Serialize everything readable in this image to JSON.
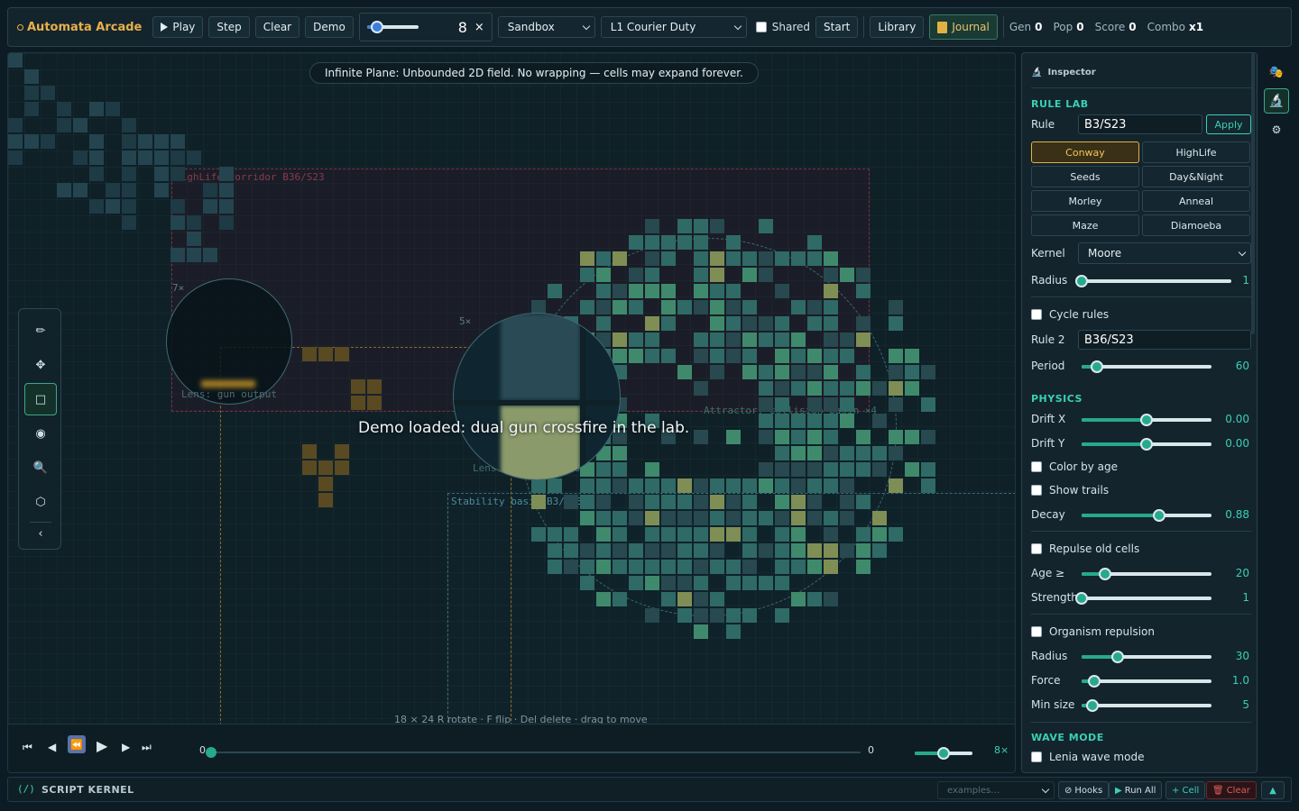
{
  "app": {
    "title": "Automata Arcade"
  },
  "toolbar": {
    "play_label": "Play",
    "step_label": "Step",
    "clear_label": "Clear",
    "demo_label": "Demo",
    "speed_value": "8",
    "speed_level": 0.2,
    "close_glyph": "×",
    "mode_select": "Sandbox",
    "level_select": "L1 Courier Duty",
    "shared_label": "Shared",
    "start_label": "Start",
    "library_label": "Library",
    "journal_label": "Journal"
  },
  "stats": {
    "gen_label": "Gen",
    "gen_value": "0",
    "pop_label": "Pop",
    "pop_value": "0",
    "score_label": "Score",
    "score_value": "0",
    "combo_label": "Combo",
    "combo_value": "x1"
  },
  "canvas": {
    "banner": "Infinite Plane: Unbounded 2D field. No wrapping — cells may expand forever.",
    "toast": "Demo loaded: dual gun crossfire in the lab.",
    "regions": {
      "highlife": "HighLife corridor  B36/S23",
      "lens_gun": "Lens: gun output",
      "lens_gun_zoom": "7×",
      "lens_collision": "Lens: collision zone",
      "lens_collision_zoom": "5×",
      "attractor": "Attractor: collision basin  ×4",
      "stability": "Stability basin  B3/S23"
    },
    "hint": "18 × 24   R rotate · F flip · Del delete · drag to move"
  },
  "tools": [
    {
      "name": "pencil-icon",
      "glyph": "✏"
    },
    {
      "name": "move-icon",
      "glyph": "✥"
    },
    {
      "name": "select-rect-icon",
      "glyph": "□"
    },
    {
      "name": "target-icon",
      "glyph": "◉"
    },
    {
      "name": "zoom-icon",
      "glyph": "🔍"
    },
    {
      "name": "hexagon-icon",
      "glyph": "⬡"
    },
    {
      "name": "collapse-icon",
      "glyph": "‹"
    }
  ],
  "timeline": {
    "start": "0",
    "end": "0",
    "progress": 0.0,
    "speed": "8×",
    "speed_level": 0.5
  },
  "panel": {
    "title": "Inspector",
    "rule_lab": {
      "heading": "RULE LAB",
      "rule_label": "Rule",
      "rule_value": "B3/S23",
      "apply_label": "Apply",
      "presets": [
        "Conway",
        "HighLife",
        "Seeds",
        "Day&Night",
        "Morley",
        "Anneal",
        "Maze",
        "Diamoeba"
      ],
      "selected": "Conway",
      "kernel_label": "Kernel",
      "kernel_value": "Moore",
      "radius_label": "Radius",
      "radius_value": "1",
      "radius_level": 0.0,
      "cycle_label": "Cycle rules",
      "rule2_label": "Rule 2",
      "rule2_value": "B36/S23",
      "period_label": "Period",
      "period_value": "60",
      "period_level": 0.12
    },
    "physics": {
      "heading": "PHYSICS",
      "drift_x_label": "Drift X",
      "drift_x_value": "0.00",
      "drift_x_level": 0.5,
      "drift_y_label": "Drift Y",
      "drift_y_value": "0.00",
      "drift_y_level": 0.5,
      "color_by_age": "Color by age",
      "show_trails": "Show trails",
      "decay_label": "Decay",
      "decay_value": "0.88",
      "decay_level": 0.6,
      "repulse_label": "Repulse old cells",
      "age_label": "Age ≥",
      "age_value": "20",
      "age_level": 0.18,
      "strength_label": "Strength",
      "strength_value": "1",
      "strength_level": 0.0,
      "org_label": "Organism repulsion",
      "org_radius_label": "Radius",
      "org_radius_value": "30",
      "org_radius_level": 0.28,
      "force_label": "Force",
      "force_value": "1.0",
      "force_level": 0.1,
      "minsize_label": "Min size",
      "minsize_value": "5",
      "minsize_level": 0.08
    },
    "wave": {
      "heading": "WAVE MODE",
      "lenia_label": "Lenia wave mode"
    }
  },
  "script": {
    "title": "SCRIPT KERNEL",
    "select_placeholder": "examples…",
    "hooks": "Hooks",
    "run_all": "Run All",
    "cell": "+ Cell",
    "clear": "Clear"
  }
}
